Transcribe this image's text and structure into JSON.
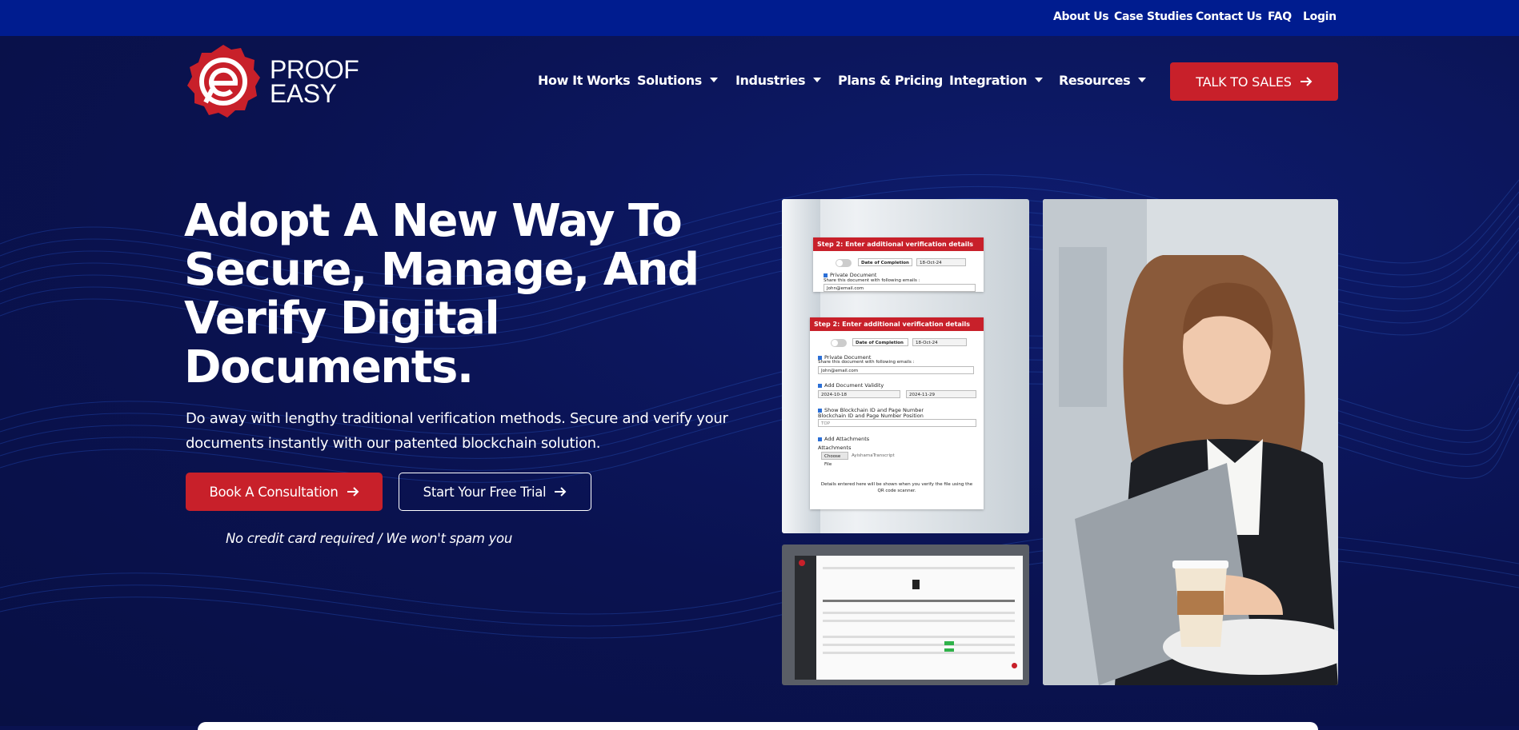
{
  "topbar": {
    "links": [
      "About Us",
      "Case Studies",
      "Contact Us",
      "FAQ",
      "Login"
    ]
  },
  "brand": {
    "line1": "PROOF",
    "line2": "EASY",
    "color": "#c8202a"
  },
  "nav": {
    "items": [
      "How It Works",
      "Solutions",
      "Industries",
      "Plans & Pricing",
      "Integration",
      "Resources"
    ],
    "cta": "TALK TO SALES"
  },
  "hero": {
    "headline_lines": [
      "Adopt A New Way To",
      "Secure, Manage, And",
      "Verify Digital",
      "Documents."
    ],
    "subtext_lines": [
      "Do away with lengthy traditional verification methods. Secure and verify your",
      "documents instantly with our patented blockchain solution."
    ],
    "primary_button": "Book A Consultation",
    "secondary_button": "Start Your Free Trial",
    "note": "No credit card required / We won't spam you"
  },
  "form_preview": {
    "header": "Step 2: Enter additional verification details",
    "date_label": "Date of Completion",
    "date_value": "18-Oct-24",
    "private_doc": "Private Document",
    "share_label": "Share this document with following emails :",
    "email": "John@email.com",
    "add_validity": "Add Document Validity",
    "valid_from": "2024-10-18",
    "valid_to": "2024-11-29",
    "show_blockchain": "Show Blockchain ID and Page Number",
    "position_label": "Blockchain ID and Page Number Position",
    "position_value": "TOP",
    "add_attachments": "Add Attachments",
    "attachments_label": "Attachments",
    "choose_file": "Choose File",
    "file_name": "AyishamaTranscript",
    "footer_note": "Details entered here will be shown when you verify the file using the QR code scanner."
  },
  "colors": {
    "topbar": "#001c8f",
    "hero": "#0a1250",
    "accent": "#c8202a"
  }
}
